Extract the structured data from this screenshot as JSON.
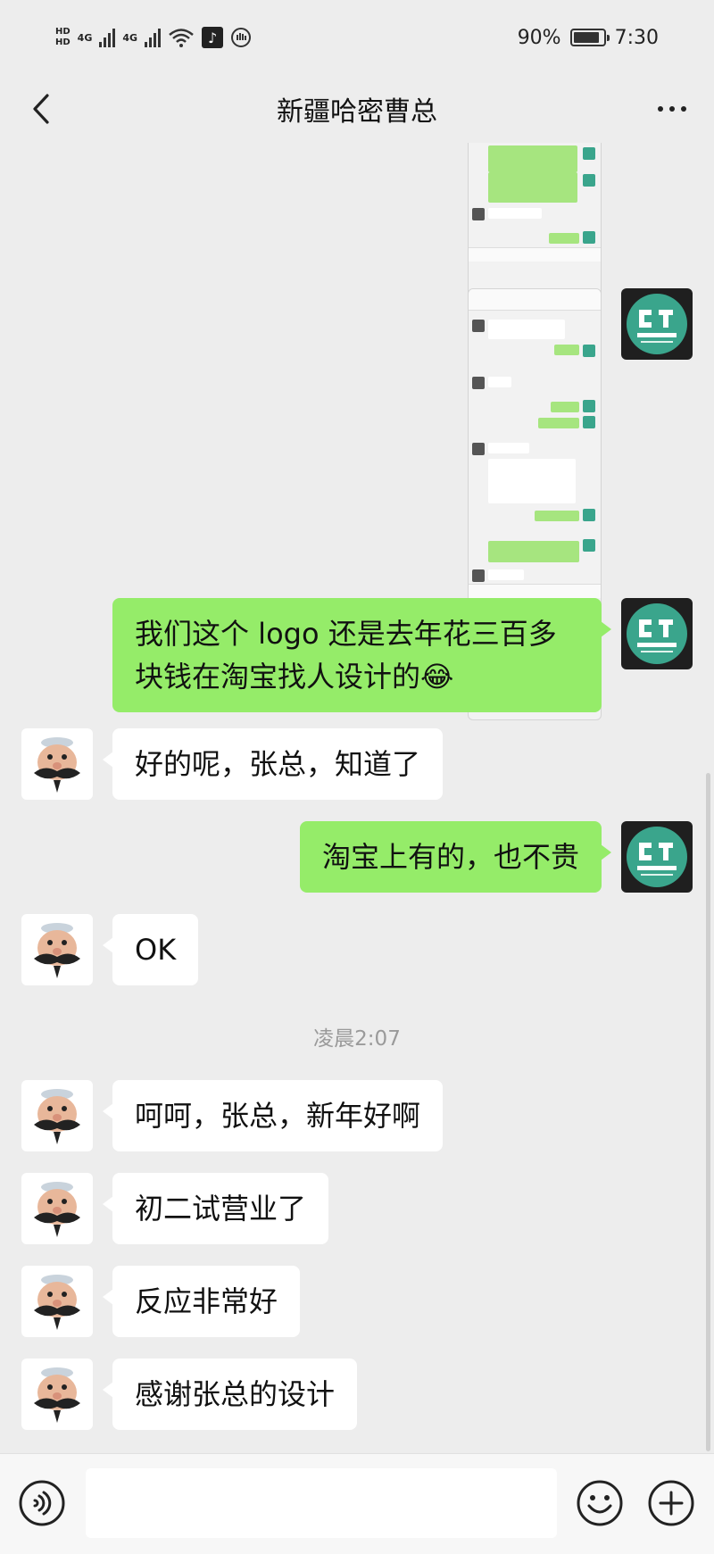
{
  "status_bar": {
    "hd_top": "HD",
    "hd_bottom": "HD",
    "net1": "4G",
    "net2": "4G",
    "battery_text": "90%",
    "battery_level": 0.9,
    "time": "7:30",
    "icons": [
      "signal-icon",
      "wifi-icon",
      "tiktok-icon",
      "notification-icon",
      "battery-icon"
    ]
  },
  "header": {
    "title": "新疆哈密曹总"
  },
  "messages": [
    {
      "sender": "me",
      "type": "image",
      "description": "chat-screenshot"
    },
    {
      "sender": "me",
      "type": "image",
      "description": "chat-screenshot"
    },
    {
      "sender": "me",
      "type": "text",
      "line1": "我们这个 logo 还是去年花三百多",
      "line2": "块钱在淘宝找人设计的😂"
    },
    {
      "sender": "them",
      "type": "text",
      "text": "好的呢，张总，知道了"
    },
    {
      "sender": "me",
      "type": "text",
      "text": "淘宝上有的，也不贵"
    },
    {
      "sender": "them",
      "type": "text",
      "text": "OK"
    },
    {
      "type": "timestamp",
      "text": "凌晨2:07"
    },
    {
      "sender": "them",
      "type": "text",
      "text": "呵呵，张总，新年好啊"
    },
    {
      "sender": "them",
      "type": "text",
      "text": "初二试营业了"
    },
    {
      "sender": "them",
      "type": "text",
      "text": "反应非常好"
    },
    {
      "sender": "them",
      "type": "text",
      "text": "感谢张总的设计"
    }
  ],
  "colors": {
    "background": "#ededed",
    "bubble_me": "#95ec69",
    "bubble_them": "#ffffff",
    "timestamp": "#9a9a9a",
    "logo_teal": "#3aa58c"
  },
  "input_bar": {
    "value": "",
    "icons": [
      "voice-icon",
      "emoji-icon",
      "plus-icon"
    ]
  }
}
